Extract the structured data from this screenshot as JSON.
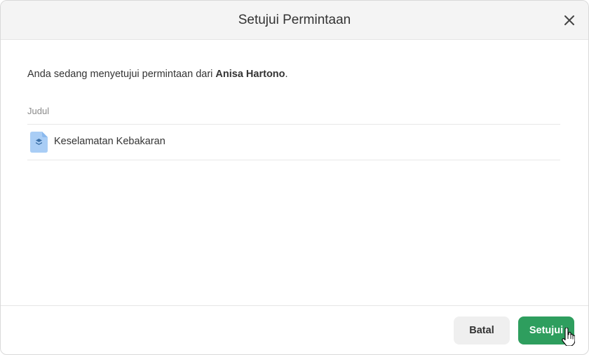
{
  "dialog": {
    "title": "Setujui Permintaan",
    "close_icon": "close-icon"
  },
  "body": {
    "intro_prefix": "Anda sedang menyetujui permintaan dari ",
    "requester_name": "Anisa Hartono",
    "intro_suffix": ".",
    "column_header": "Judul",
    "items": [
      {
        "icon": "document-icon",
        "icon_color": "#a9cdf5",
        "label": "Keselamatan Kebakaran"
      }
    ]
  },
  "footer": {
    "cancel_label": "Batal",
    "approve_label": "Setujui",
    "approve_color": "#2e9e5e"
  }
}
